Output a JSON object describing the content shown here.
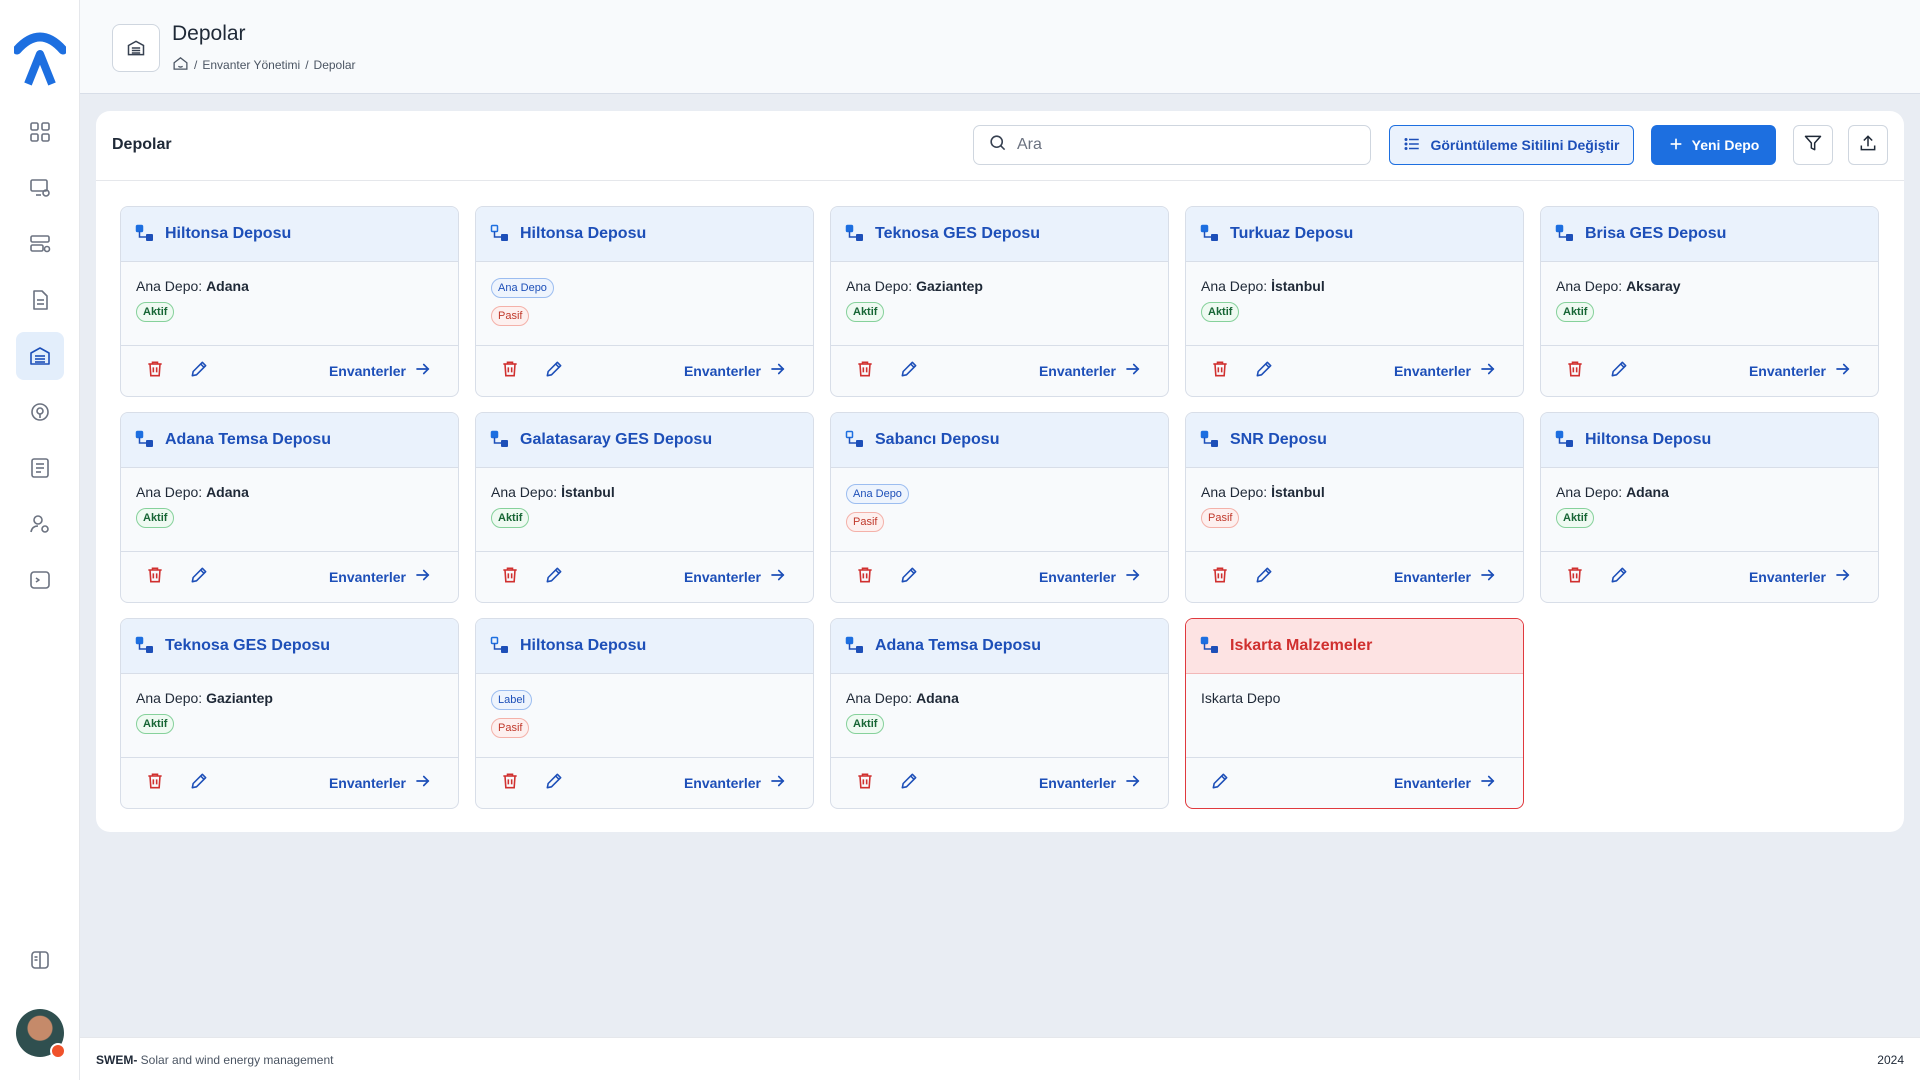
{
  "page": {
    "title": "Depolar",
    "breadcrumb": [
      "Envanter Yönetimi",
      "Depolar"
    ]
  },
  "sidebar": {
    "items": [
      {
        "icon": "dashboard-icon",
        "active": false
      },
      {
        "icon": "monitor-settings-icon",
        "active": false
      },
      {
        "icon": "server-settings-icon",
        "active": false
      },
      {
        "icon": "document-icon",
        "active": false
      },
      {
        "icon": "warehouse-icon",
        "active": true
      },
      {
        "icon": "plant-settings-icon",
        "active": false
      },
      {
        "icon": "report-list-icon",
        "active": false
      },
      {
        "icon": "user-settings-icon",
        "active": false
      },
      {
        "icon": "terminal-icon",
        "active": false
      }
    ],
    "bottom_icon": "book-icon"
  },
  "panel": {
    "title": "Depolar",
    "search_placeholder": "Ara",
    "view_button": "Görüntüleme Sitilini Değiştir",
    "new_button": "Yeni Depo"
  },
  "cards": [
    {
      "title": "Hiltonsa Deposu",
      "label": "Ana Depo:",
      "value": "Adana",
      "status": "Aktif"
    },
    {
      "title": "Hiltonsa Deposu",
      "tag": "Ana Depo",
      "status": "Pasif"
    },
    {
      "title": "Teknosa GES Deposu",
      "label": "Ana Depo:",
      "value": "Gaziantep",
      "status": "Aktif"
    },
    {
      "title": "Turkuaz Deposu",
      "label": "Ana Depo:",
      "value": "İstanbul",
      "status": "Aktif"
    },
    {
      "title": "Brisa GES Deposu",
      "label": "Ana Depo:",
      "value": "Aksaray",
      "status": "Aktif"
    },
    {
      "title": "Adana Temsa Deposu",
      "label": "Ana Depo:",
      "value": "Adana",
      "status": "Aktif"
    },
    {
      "title": "Galatasaray GES Deposu",
      "label": "Ana Depo:",
      "value": "İstanbul",
      "status": "Aktif"
    },
    {
      "title": "Sabancı Deposu",
      "tag": "Ana Depo",
      "status": "Pasif"
    },
    {
      "title": "SNR Deposu",
      "label": "Ana Depo:",
      "value": "İstanbul",
      "status": "Pasif"
    },
    {
      "title": "Hiltonsa Deposu",
      "label": "Ana Depo:",
      "value": "Adana",
      "status": "Aktif"
    },
    {
      "title": "Teknosa GES Deposu",
      "label": "Ana Depo:",
      "value": "Gaziantep",
      "status": "Aktif"
    },
    {
      "title": "Hiltonsa Deposu",
      "tag": "Label",
      "status": "Pasif"
    },
    {
      "title": "Adana Temsa Deposu",
      "label": "Ana Depo:",
      "value": "Adana",
      "status": "Aktif"
    },
    {
      "title": "Iskarta Malzemeler",
      "text": "Iskarta Depo",
      "danger": true
    }
  ],
  "card_action": "Envanterler",
  "footer": {
    "brand": "SWEM-",
    "tagline": "Solar and wind energy management",
    "year": "2024"
  },
  "colors": {
    "primary": "#1d6fe0",
    "link": "#1d4fb8",
    "danger": "#d0302f",
    "active_tag": "#166534",
    "passive_tag": "#c0392b"
  }
}
